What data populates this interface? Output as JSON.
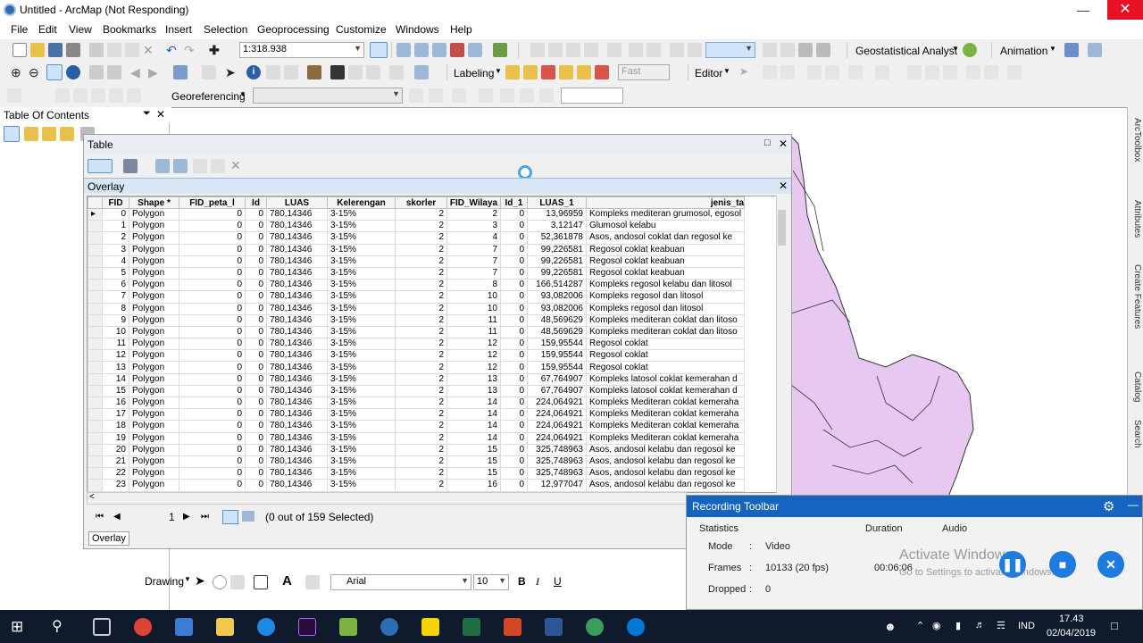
{
  "window": {
    "title": "Untitled - ArcMap (Not Responding)"
  },
  "menu": [
    "File",
    "Edit",
    "View",
    "Bookmarks",
    "Insert",
    "Selection",
    "Geoprocessing",
    "Customize",
    "Windows",
    "Help"
  ],
  "toolbar": {
    "scale": "1:318.938",
    "geostatistical": "Geostatistical Analyst",
    "animation": "Animation",
    "labeling": "Labeling",
    "speed": "Fast",
    "editor": "Editor",
    "georeferencing": "Georeferencing"
  },
  "toc": {
    "title": "Table Of Contents"
  },
  "table_window": {
    "title": "Table",
    "tab_title": "Overlay",
    "columns": [
      "FID",
      "Shape *",
      "FID_peta_l",
      "Id",
      "LUAS",
      "Kelerengan",
      "skorler",
      "FID_Wilaya",
      "Id_1",
      "LUAS_1",
      "jenis_ta"
    ],
    "rows": [
      [
        "0",
        "Polygon",
        "0",
        "0",
        "780,14346",
        "3-15%",
        "2",
        "2",
        "0",
        "13,96959",
        "Kompleks mediteran grumosol, egosol"
      ],
      [
        "1",
        "Polygon",
        "0",
        "0",
        "780,14346",
        "3-15%",
        "2",
        "3",
        "0",
        "3,12147",
        "Glumosol kelabu"
      ],
      [
        "2",
        "Polygon",
        "0",
        "0",
        "780,14346",
        "3-15%",
        "2",
        "4",
        "0",
        "52,361878",
        "Asos, andosol coklat dan regosol ke"
      ],
      [
        "3",
        "Polygon",
        "0",
        "0",
        "780,14346",
        "3-15%",
        "2",
        "7",
        "0",
        "99,226581",
        "Regosol coklat keabuan"
      ],
      [
        "4",
        "Polygon",
        "0",
        "0",
        "780,14346",
        "3-15%",
        "2",
        "7",
        "0",
        "99,226581",
        "Regosol coklat keabuan"
      ],
      [
        "5",
        "Polygon",
        "0",
        "0",
        "780,14346",
        "3-15%",
        "2",
        "7",
        "0",
        "99,226581",
        "Regosol coklat keabuan"
      ],
      [
        "6",
        "Polygon",
        "0",
        "0",
        "780,14346",
        "3-15%",
        "2",
        "8",
        "0",
        "166,514287",
        "Kompleks regosol kelabu dan litosol"
      ],
      [
        "7",
        "Polygon",
        "0",
        "0",
        "780,14346",
        "3-15%",
        "2",
        "10",
        "0",
        "93,082006",
        "Kompleks regosol dan litosol"
      ],
      [
        "8",
        "Polygon",
        "0",
        "0",
        "780,14346",
        "3-15%",
        "2",
        "10",
        "0",
        "93,082006",
        "Kompleks regosol dan litosol"
      ],
      [
        "9",
        "Polygon",
        "0",
        "0",
        "780,14346",
        "3-15%",
        "2",
        "11",
        "0",
        "48,569629",
        "Kompleks mediteran coklat dan litoso"
      ],
      [
        "10",
        "Polygon",
        "0",
        "0",
        "780,14346",
        "3-15%",
        "2",
        "11",
        "0",
        "48,569629",
        "Kompleks mediteran coklat dan litoso"
      ],
      [
        "11",
        "Polygon",
        "0",
        "0",
        "780,14346",
        "3-15%",
        "2",
        "12",
        "0",
        "159,95544",
        "Regosol coklat"
      ],
      [
        "12",
        "Polygon",
        "0",
        "0",
        "780,14346",
        "3-15%",
        "2",
        "12",
        "0",
        "159,95544",
        "Regosol coklat"
      ],
      [
        "13",
        "Polygon",
        "0",
        "0",
        "780,14346",
        "3-15%",
        "2",
        "12",
        "0",
        "159,95544",
        "Regosol coklat"
      ],
      [
        "14",
        "Polygon",
        "0",
        "0",
        "780,14346",
        "3-15%",
        "2",
        "13",
        "0",
        "67,764907",
        "Kompleks latosol coklat kemerahan d"
      ],
      [
        "15",
        "Polygon",
        "0",
        "0",
        "780,14346",
        "3-15%",
        "2",
        "13",
        "0",
        "67,764907",
        "Kompleks latosol coklat kemerahan d"
      ],
      [
        "16",
        "Polygon",
        "0",
        "0",
        "780,14346",
        "3-15%",
        "2",
        "14",
        "0",
        "224,064921",
        "Kompleks Mediteran coklat kemeraha"
      ],
      [
        "17",
        "Polygon",
        "0",
        "0",
        "780,14346",
        "3-15%",
        "2",
        "14",
        "0",
        "224,064921",
        "Kompleks Mediteran coklat kemeraha"
      ],
      [
        "18",
        "Polygon",
        "0",
        "0",
        "780,14346",
        "3-15%",
        "2",
        "14",
        "0",
        "224,064921",
        "Kompleks Mediteran coklat kemeraha"
      ],
      [
        "19",
        "Polygon",
        "0",
        "0",
        "780,14346",
        "3-15%",
        "2",
        "14",
        "0",
        "224,064921",
        "Kompleks Mediteran coklat kemeraha"
      ],
      [
        "20",
        "Polygon",
        "0",
        "0",
        "780,14346",
        "3-15%",
        "2",
        "15",
        "0",
        "325,748963",
        "Asos, andosol kelabu dan regosol ke"
      ],
      [
        "21",
        "Polygon",
        "0",
        "0",
        "780,14346",
        "3-15%",
        "2",
        "15",
        "0",
        "325,748963",
        "Asos, andosol kelabu dan regosol ke"
      ],
      [
        "22",
        "Polygon",
        "0",
        "0",
        "780,14346",
        "3-15%",
        "2",
        "15",
        "0",
        "325,748963",
        "Asos, andosol kelabu dan regosol ke"
      ],
      [
        "23",
        "Polygon",
        "0",
        "0",
        "780,14346",
        "3-15%",
        "2",
        "16",
        "0",
        "12,977047",
        "Asos, andosol kelabu dan regosol ke"
      ]
    ],
    "record_number": "1",
    "selection_status": "(0 out of 159 Selected)",
    "bottom_tab": "Overlay"
  },
  "drawing_toolbar": {
    "label": "Drawing",
    "font": "Arial",
    "font_size": "10",
    "bold": "B",
    "italic": "I",
    "underline": "U"
  },
  "recording_toolbar": {
    "title": "Recording Toolbar",
    "statistics_label": "Statistics",
    "duration_label": "Duration",
    "audio_label": "Audio",
    "mode_label": "Mode",
    "mode_value": "Video",
    "frames_label": "Frames",
    "frames_value": "10133 (20 fps)",
    "dropped_label": "Dropped",
    "dropped_value": "0",
    "duration_value": "00:06:06",
    "watermark_line1": "Activate Windows",
    "watermark_line2": "Go to Settings to activate Windows."
  },
  "dock_tabs": [
    "ArcToolbox",
    "Attributes",
    "Create Features",
    "Catalog",
    "Search"
  ],
  "taskbar": {
    "language": "IND",
    "time": "17.43",
    "date": "02/04/2019"
  },
  "colors": {
    "map_fill": "#e6c8f0",
    "map_stroke": "#333333",
    "rec_blue": "#1e7be0",
    "taskbar": "#0f1b2d"
  }
}
